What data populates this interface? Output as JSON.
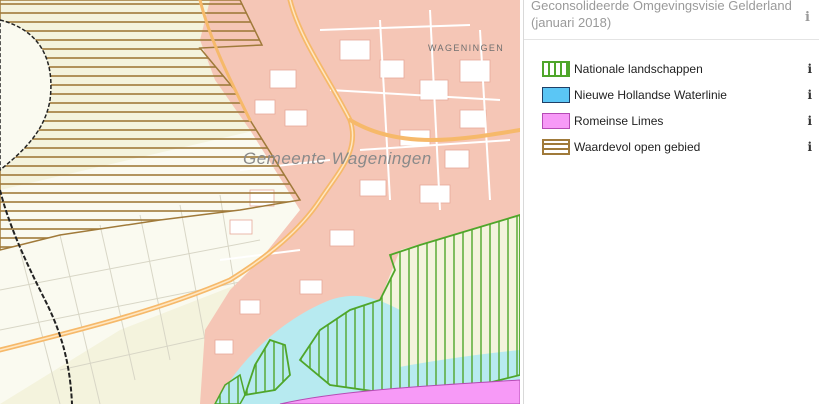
{
  "map": {
    "municipality_label": "Gemeente Wageningen",
    "town_label": "WAGENINGEN"
  },
  "panel": {
    "title": "Geconsolideerde Omgevingsvisie Gelderland\n(januari 2018)",
    "info_icon": "info-icon"
  },
  "legend": {
    "items": [
      {
        "label": "Nationale landschappen",
        "pattern": "vertical-hatch",
        "stroke": "#4fa62a",
        "fill": "#ffffff"
      },
      {
        "label": "Nieuwe Hollandse Waterlinie",
        "pattern": "solid",
        "stroke": "#1f3f66",
        "fill": "#5bc6f5"
      },
      {
        "label": "Romeinse Limes",
        "pattern": "solid",
        "stroke": "#b64bb6",
        "fill": "#f79af7"
      },
      {
        "label": "Waardevol open gebied",
        "pattern": "horizontal-hatch",
        "stroke": "#a07a3a",
        "fill": "#ffffff"
      }
    ]
  },
  "colors": {
    "urban": "#f5c6b6",
    "rural": "#f4f3dd",
    "water": "#b7eaf0",
    "road": "#f6b96a",
    "nationale": "#4fa62a",
    "waardevol": "#a07a3a",
    "limes": "#f79af7"
  }
}
